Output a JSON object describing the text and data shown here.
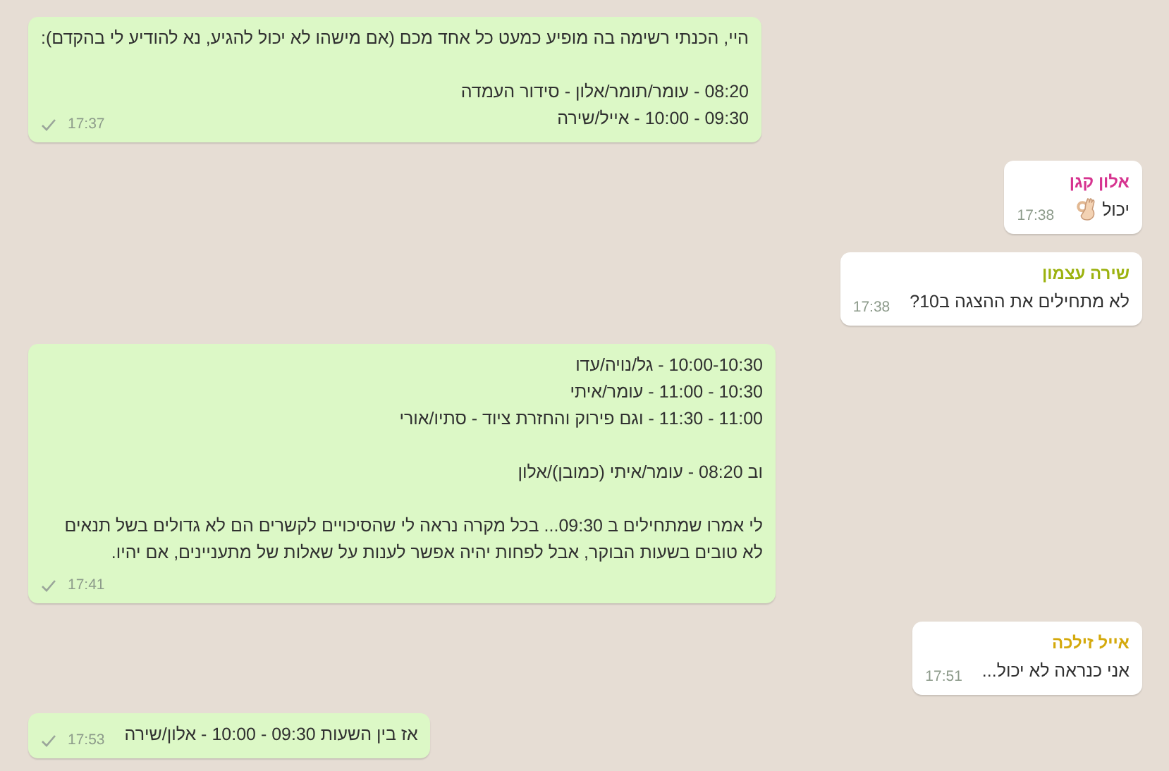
{
  "messages": [
    {
      "kind": "outgoing",
      "paragraphs": [
        [
          "היי, הכנתי רשימה בה מופיע כמעט כל אחד מכם (אם מישהו לא יכול להגיע, נא להודיע לי בהקדם):"
        ],
        [
          "08:20 - עומר/תומר/אלון - סידור העמדה",
          "09:30 - 10:00 - אייל/שירה"
        ]
      ],
      "time": "17:37",
      "sent": true
    },
    {
      "kind": "incoming",
      "sender": "אלון קגן",
      "color": "#d6338f",
      "paragraphs": [
        [
          "יכול"
        ]
      ],
      "emoji": true,
      "time": "17:38"
    },
    {
      "kind": "incoming",
      "sender": "שירה עצמון",
      "color": "#9cb20f",
      "paragraphs": [
        [
          "לא מתחילים את ההצגה ב10?"
        ]
      ],
      "time": "17:38"
    },
    {
      "kind": "outgoing",
      "paragraphs": [
        [
          "10:00-10:30 - גל/נויה/עדו",
          "10:30 - 11:00 - עומר/איתי",
          "11:00 - 11:30 - וגם פירוק והחזרת ציוד - סתיו/אורי"
        ],
        [
          "וב 08:20 - עומר/איתי (כמובן)/אלון"
        ],
        [
          "לי אמרו שמתחילים ב 09:30... בכל מקרה נראה לי שהסיכויים לקשרים הם לא גדולים בשל תנאים לא טובים בשעות הבוקר, אבל לפחות יהיה אפשר לענות על שאלות של מתעניינים, אם יהיו."
        ]
      ],
      "time": "17:41",
      "sent": true
    },
    {
      "kind": "incoming",
      "sender": "אייל זילכה",
      "color": "#d4a90c",
      "paragraphs": [
        [
          "אני כנראה לא יכול..."
        ]
      ],
      "time": "17:51"
    },
    {
      "kind": "outgoing",
      "paragraphs": [
        [
          "אז בין השעות 09:30 - 10:00 - אלון/שירה"
        ]
      ],
      "time": "17:53",
      "sent": true
    }
  ]
}
